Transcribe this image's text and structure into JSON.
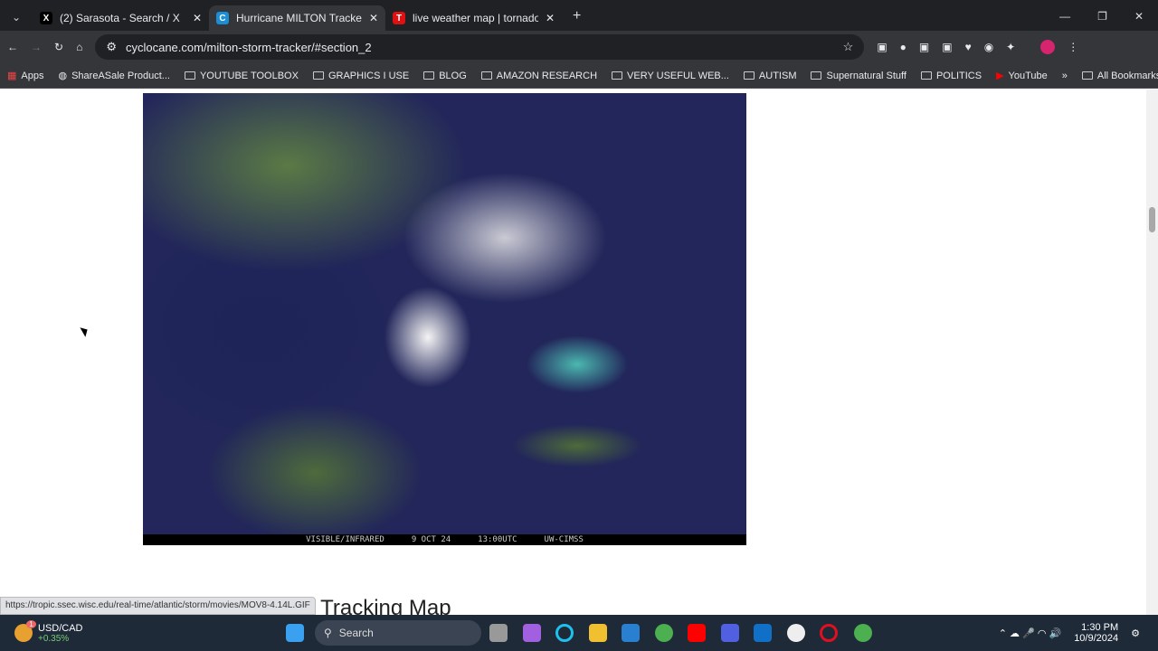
{
  "tabs": [
    {
      "label": "(2) Sarasota - Search / X",
      "icon": "x-icon",
      "active": false
    },
    {
      "label": "Hurricane MILTON Tracker | Cyclocane",
      "icon": "cyclocane-icon",
      "active": true
    },
    {
      "label": "live weather map | tornado hq",
      "icon": "tornado-hq-icon",
      "active": false
    }
  ],
  "address": "cyclocane.com/milton-storm-tracker/#section_2",
  "bookmarks": [
    "Apps",
    "ShareASale Product...",
    "YOUTUBE TOOLBOX",
    "GRAPHICS I USE",
    "BLOG",
    "AMAZON RESEARCH",
    "VERY USEFUL WEB...",
    "AUTISM",
    "Supernatural Stuff",
    "POLITICS",
    "YouTube"
  ],
  "all_bookmarks": "All Bookmarks",
  "satellite": {
    "caption": [
      "VISIBLE/INFRARED",
      "9 OCT 24",
      "13:00UTC",
      "UW-CIMSS"
    ]
  },
  "heading": "MILTON Alternate Tracking Map",
  "status_url": "https://tropic.ssec.wisc.edu/real-time/atlantic/storm/movies/MOV8-4.14L.GIF",
  "taskbar": {
    "ticker": "USD/CAD",
    "change": "+0.35%",
    "badge": "1",
    "search": "Search",
    "time": "1:30 PM",
    "date": "10/9/2024"
  }
}
